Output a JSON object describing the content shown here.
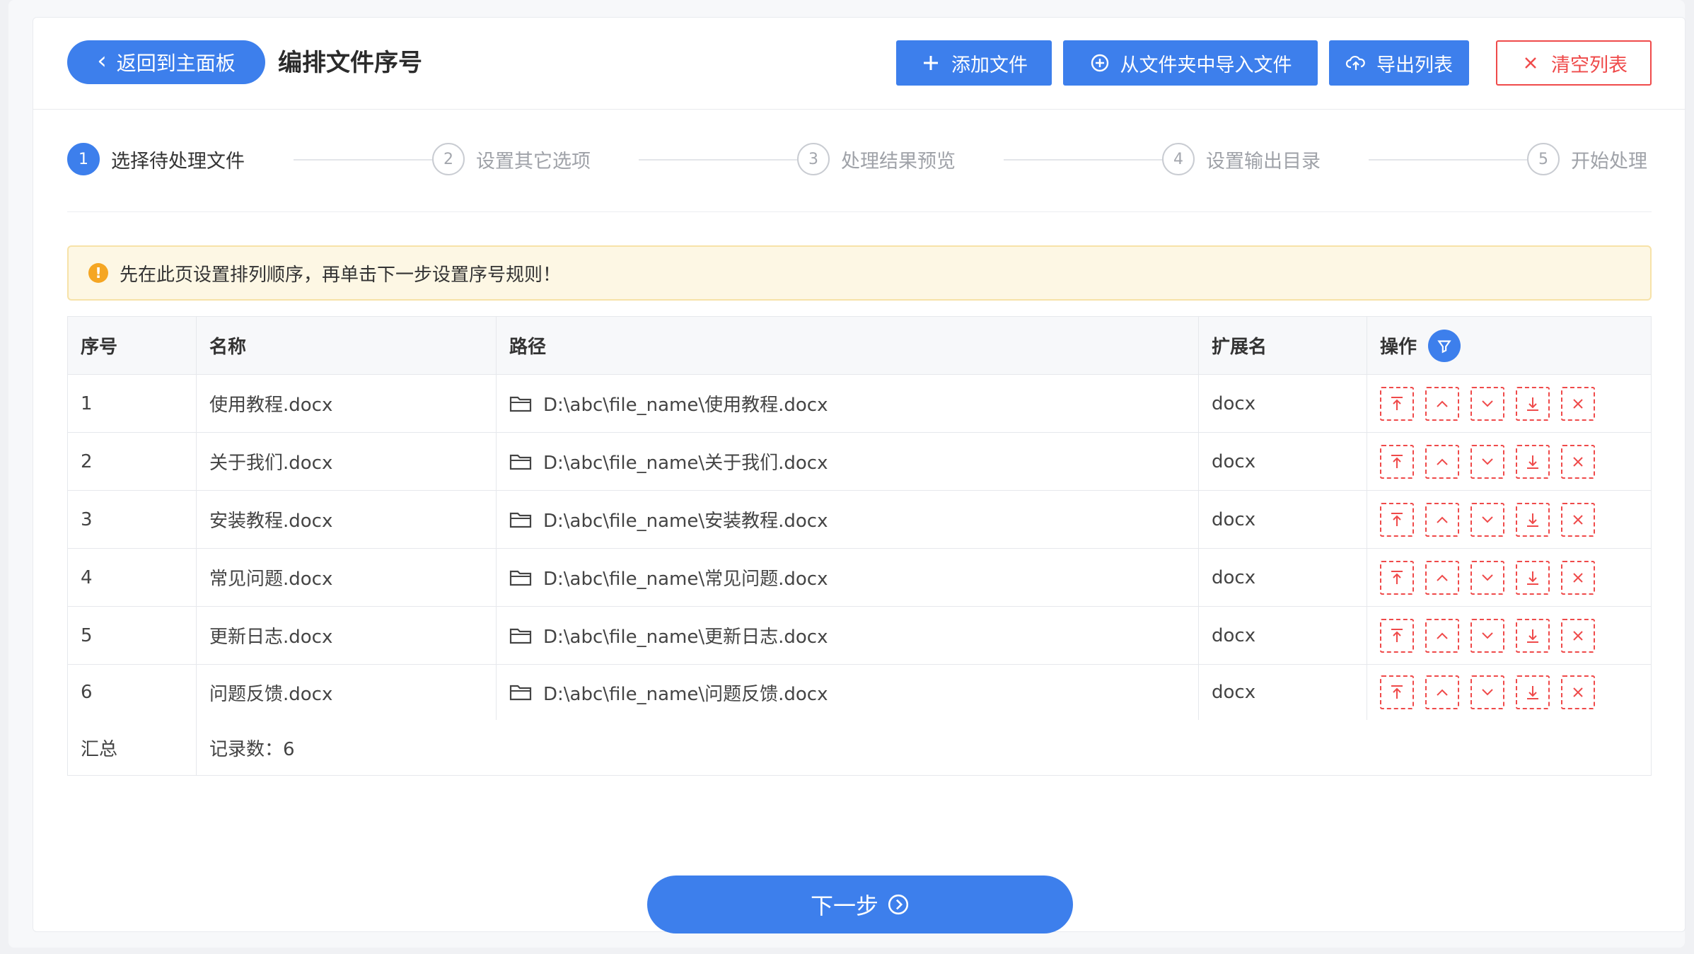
{
  "header": {
    "back_label": "返回到主面板",
    "title": "编排文件序号",
    "buttons": {
      "add_file": "添加文件",
      "import_folder": "从文件夹中导入文件",
      "export_list": "导出列表",
      "clear_list": "清空列表"
    }
  },
  "steps": [
    {
      "num": "1",
      "label": "选择待处理文件"
    },
    {
      "num": "2",
      "label": "设置其它选项"
    },
    {
      "num": "3",
      "label": "处理结果预览"
    },
    {
      "num": "4",
      "label": "设置输出目录"
    },
    {
      "num": "5",
      "label": "开始处理"
    }
  ],
  "alert": {
    "text": "先在此页设置排列顺序，再单击下一步设置序号规则！"
  },
  "table": {
    "headers": {
      "index": "序号",
      "name": "名称",
      "path": "路径",
      "ext": "扩展名",
      "ops": "操作"
    },
    "rows": [
      {
        "index": "1",
        "name": "使用教程.docx",
        "path": "D:\\abc\\file_name\\使用教程.docx",
        "ext": "docx"
      },
      {
        "index": "2",
        "name": "关于我们.docx",
        "path": "D:\\abc\\file_name\\关于我们.docx",
        "ext": "docx"
      },
      {
        "index": "3",
        "name": "安装教程.docx",
        "path": "D:\\abc\\file_name\\安装教程.docx",
        "ext": "docx"
      },
      {
        "index": "4",
        "name": "常见问题.docx",
        "path": "D:\\abc\\file_name\\常见问题.docx",
        "ext": "docx"
      },
      {
        "index": "5",
        "name": "更新日志.docx",
        "path": "D:\\abc\\file_name\\更新日志.docx",
        "ext": "docx"
      },
      {
        "index": "6",
        "name": "问题反馈.docx",
        "path": "D:\\abc\\file_name\\问题反馈.docx",
        "ext": "docx"
      }
    ],
    "summary": {
      "label": "汇总",
      "count_text": "记录数：6"
    }
  },
  "footer": {
    "next_label": "下一步"
  },
  "colors": {
    "primary": "#3d7fec",
    "danger": "#ef4a4a",
    "warning": "#f5a623"
  },
  "icons": {
    "ops": [
      "move-top-icon",
      "move-up-icon",
      "move-down-icon",
      "move-bottom-icon",
      "delete-icon"
    ]
  }
}
